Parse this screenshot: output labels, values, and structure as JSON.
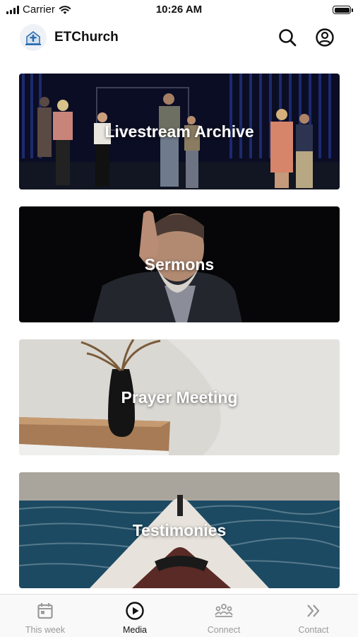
{
  "status_bar": {
    "carrier": "Carrier",
    "time": "10:26 AM"
  },
  "header": {
    "title": "ETChurch",
    "icons": [
      "church-logo-icon",
      "search-icon",
      "account-icon"
    ]
  },
  "cards": [
    {
      "label": "Livestream Archive"
    },
    {
      "label": "Sermons"
    },
    {
      "label": "Prayer Meeting"
    },
    {
      "label": "Testimonies"
    }
  ],
  "tabs": [
    {
      "label": "This week",
      "icon": "calendar-icon",
      "active": false
    },
    {
      "label": "Media",
      "icon": "play-circle-icon",
      "active": true
    },
    {
      "label": "Connect",
      "icon": "people-icon",
      "active": false
    },
    {
      "label": "Contact",
      "icon": "double-chevron-right-icon",
      "active": false
    }
  ],
  "colors": {
    "active_tab": "#111111",
    "inactive_tab": "#9a9a9a",
    "accent_logo": "#2b6cb0"
  }
}
